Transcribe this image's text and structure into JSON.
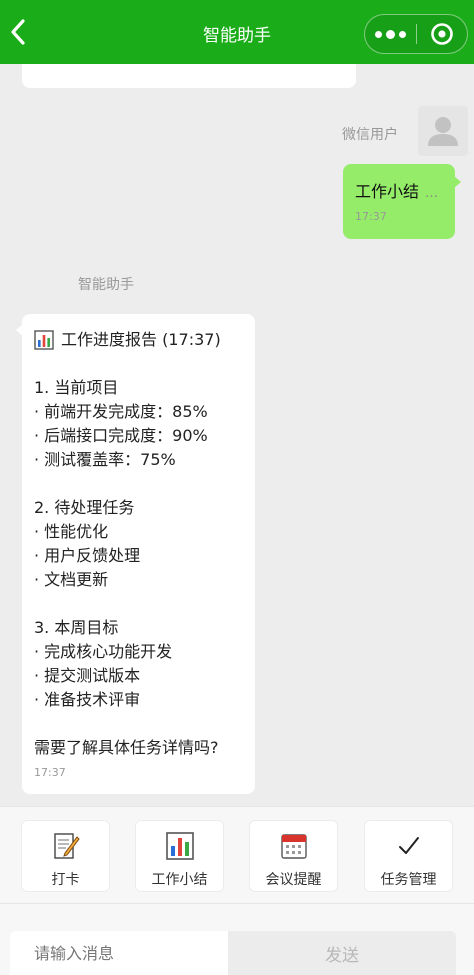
{
  "header": {
    "title": "智能助手",
    "back_icon": "chevron-left-icon",
    "more_icon": "more-dots-icon",
    "close_icon": "target-close-icon",
    "color": "#1aad19"
  },
  "user_message": {
    "sender": "微信用户",
    "text": "工作小结",
    "status": "…",
    "time": "17:37",
    "bubble_color": "#95ec69"
  },
  "bot_message": {
    "sender": "智能助手",
    "title": "工作进度报告 (17:37)",
    "title_icon": "bar-chart-icon",
    "section1": {
      "heading": "1. 当前项目",
      "items": [
        "· 前端开发完成度：85%",
        "· 后端接口完成度：90%",
        "· 测试覆盖率：75%"
      ]
    },
    "section2": {
      "heading": "2. 待处理任务",
      "items": [
        "· 性能优化",
        "· 用户反馈处理",
        "· 文档更新"
      ]
    },
    "section3": {
      "heading": "3. 本周目标",
      "items": [
        "· 完成核心功能开发",
        "· 提交测试版本",
        "· 准备技术评审"
      ]
    },
    "question": "需要了解具体任务详情吗?",
    "time": "17:37"
  },
  "quick_actions": [
    {
      "label": "打卡",
      "icon": "memo-icon"
    },
    {
      "label": "工作小结",
      "icon": "bar-chart-icon"
    },
    {
      "label": "会议提醒",
      "icon": "calendar-icon"
    },
    {
      "label": "任务管理",
      "icon": "checkmark-icon"
    }
  ],
  "input": {
    "placeholder": "请输入消息",
    "send_label": "发送"
  }
}
